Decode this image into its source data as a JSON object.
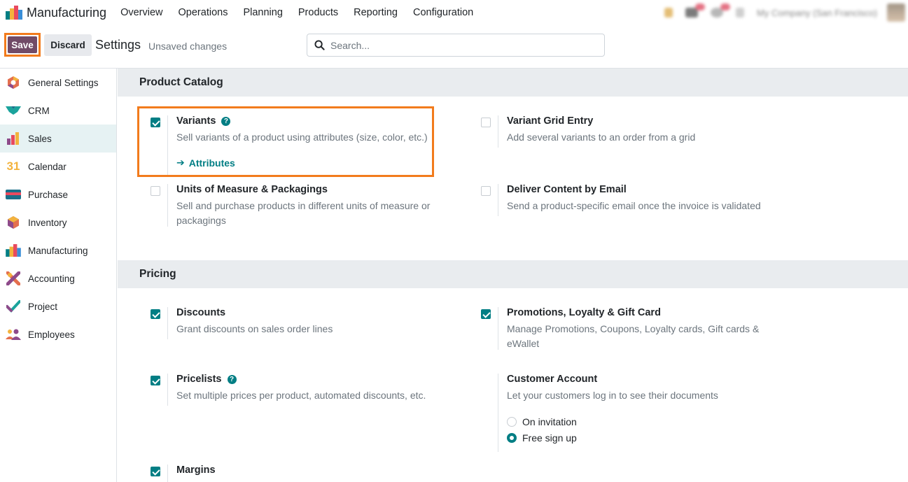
{
  "navbar": {
    "app_name": "Manufacturing",
    "menu": [
      "Overview",
      "Operations",
      "Planning",
      "Products",
      "Reporting",
      "Configuration"
    ],
    "company": "My Company (San Francisco)"
  },
  "controlbar": {
    "save_label": "Save",
    "discard_label": "Discard",
    "title": "Settings",
    "status": "Unsaved changes",
    "search_placeholder": "Search..."
  },
  "sidebar": {
    "items": [
      {
        "label": "General Settings",
        "icon": "general-settings-icon"
      },
      {
        "label": "CRM",
        "icon": "crm-icon"
      },
      {
        "label": "Sales",
        "icon": "sales-icon",
        "active": true
      },
      {
        "label": "Calendar",
        "icon": "calendar-icon"
      },
      {
        "label": "Purchase",
        "icon": "purchase-icon"
      },
      {
        "label": "Inventory",
        "icon": "inventory-icon"
      },
      {
        "label": "Manufacturing",
        "icon": "manufacturing-icon"
      },
      {
        "label": "Accounting",
        "icon": "accounting-icon"
      },
      {
        "label": "Project",
        "icon": "project-icon"
      },
      {
        "label": "Employees",
        "icon": "employees-icon"
      }
    ]
  },
  "calendar_icon_text": "31",
  "sections": {
    "product_catalog": {
      "title": "Product Catalog",
      "variants": {
        "title": "Variants",
        "desc": "Sell variants of a product using attributes (size, color, etc.)",
        "link": "Attributes",
        "checked": true
      },
      "variant_grid": {
        "title": "Variant Grid Entry",
        "desc": "Add several variants to an order from a grid",
        "checked": false
      },
      "uom": {
        "title": "Units of Measure & Packagings",
        "desc": "Sell and purchase products in different units of measure or packagings",
        "checked": false
      },
      "deliver_email": {
        "title": "Deliver Content by Email",
        "desc": "Send a product-specific email once the invoice is validated",
        "checked": false
      }
    },
    "pricing": {
      "title": "Pricing",
      "discounts": {
        "title": "Discounts",
        "desc": "Grant discounts on sales order lines",
        "checked": true
      },
      "promotions": {
        "title": "Promotions, Loyalty & Gift Card",
        "desc": "Manage Promotions, Coupons, Loyalty cards, Gift cards & eWallet",
        "checked": true
      },
      "pricelists": {
        "title": "Pricelists",
        "desc": "Set multiple prices per product, automated discounts, etc.",
        "checked": true
      },
      "customer_account": {
        "title": "Customer Account",
        "desc": "Let your customers log in to see their documents",
        "options": [
          "On invitation",
          "Free sign up"
        ],
        "selected": "Free sign up"
      },
      "margins": {
        "title": "Margins",
        "checked": true
      }
    }
  },
  "colors": {
    "accent": "#017e84",
    "brand": "#714b67",
    "highlight": "#f27b1c"
  }
}
